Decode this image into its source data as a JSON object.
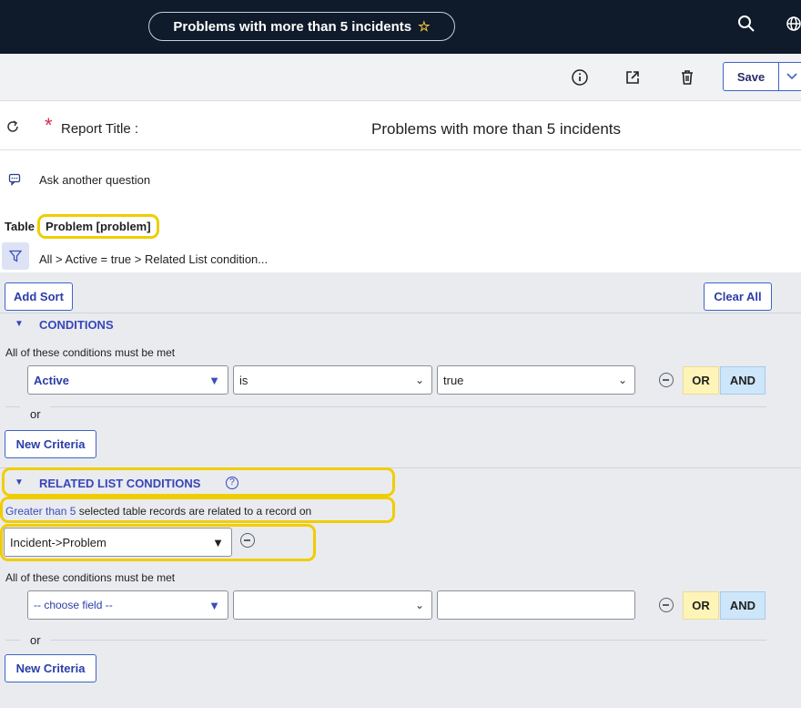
{
  "header": {
    "title": "Problems with more than 5 incidents",
    "star_icon": "star-outline-icon",
    "search_icon": "search-icon",
    "globe_icon": "globe-icon"
  },
  "toolbar": {
    "info_icon": "info-icon",
    "share_icon": "share-icon",
    "delete_icon": "trash-icon",
    "save_label": "Save",
    "save_menu_icon": "chevron-down-icon"
  },
  "report": {
    "refresh_icon": "refresh-icon",
    "required_mark": "*",
    "title_label": "Report Title :",
    "title_value": "Problems with more than 5 incidents",
    "ask_label": "Ask another question",
    "table_label": "Table",
    "table_value": "Problem [problem]",
    "breadcrumb": "All > Active = true > Related List condition..."
  },
  "filter": {
    "add_sort_label": "Add Sort",
    "clear_all_label": "Clear All",
    "conditions": {
      "header": "CONDITIONS",
      "must_be_met": "All of these conditions must be met",
      "field": "Active",
      "operator": "is",
      "value": "true",
      "or_label": "OR",
      "and_label": "AND",
      "or_separator": "or",
      "new_criteria_label": "New Criteria"
    },
    "related_list": {
      "header": "RELATED LIST CONDITIONS",
      "quantity_link": "Greater than 5",
      "description": "selected table records are related to a record on",
      "relation": "Incident->Problem",
      "must_be_met": "All of these conditions must be met",
      "field": "-- choose field --",
      "operator": "",
      "value": "",
      "or_label": "OR",
      "and_label": "AND",
      "or_separator": "or",
      "new_criteria_label": "New Criteria"
    }
  },
  "colors": {
    "header_bg": "#0f1a2a",
    "accent": "#3846b8",
    "highlight": "#f0cd00",
    "or_bg": "#fff4b8",
    "and_bg": "#cde6fa"
  }
}
